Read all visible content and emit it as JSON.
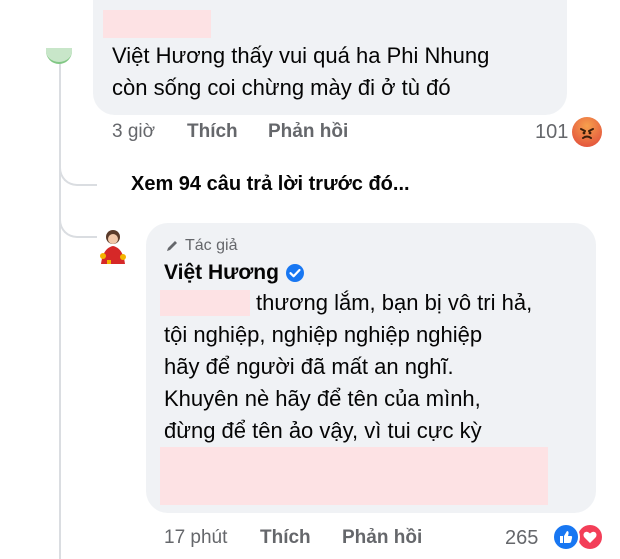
{
  "comment1": {
    "lines": [
      "Việt Hương thấy vui quá ha Phi Nhung",
      "còn sống coi chừng mày đi ở tù đó"
    ],
    "time": "3 giờ",
    "like_label": "Thích",
    "reply_label": "Phản hồi",
    "reaction_count": "101",
    "reaction_icon": "angry-reaction-icon"
  },
  "view_more": "Xem 94 câu trả lời trước đó...",
  "reply": {
    "author_badge": "Tác giả",
    "author_name": "Việt Hương",
    "verified_icon": "verified-badge-icon",
    "lines": [
      "thương lắm, bạn bị vô tri hả,",
      "tội nghiệp, nghiệp nghiệp nghiệp",
      "hãy để người đã mất an nghĩ.",
      "Khuyên nè hãy để tên của mình,",
      "đừng để tên ảo vậy, vì tui cực kỳ"
    ],
    "time": "17 phút",
    "like_label": "Thích",
    "reply_label": "Phản hồi",
    "reaction_count": "265",
    "reaction_icons": [
      "like-reaction-icon",
      "love-reaction-icon"
    ]
  },
  "colors": {
    "bubble": "#f0f2f5",
    "meta_text": "#65676b",
    "verified": "#1877f2",
    "redaction": "#fde2e4"
  }
}
